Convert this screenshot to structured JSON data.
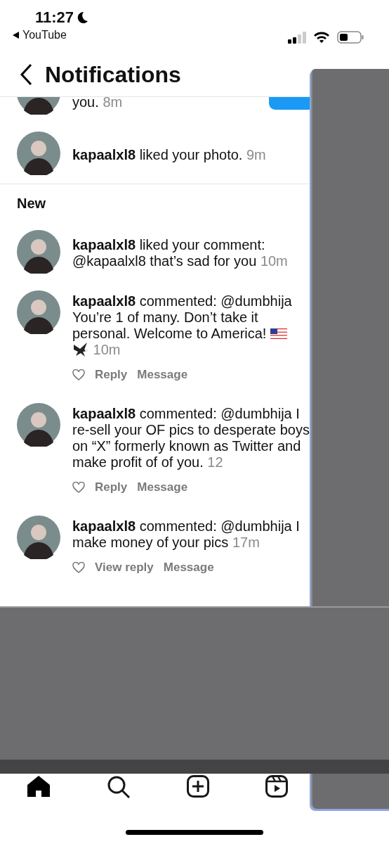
{
  "status_bar": {
    "time": "11:27",
    "back_app": "YouTube"
  },
  "header": {
    "title": "Notifications"
  },
  "earlier": [
    {
      "kind": "partial",
      "text": "you.",
      "time": "8m",
      "button": true
    },
    {
      "kind": "like",
      "text": "**kapaalxl8** liked your photo.",
      "time": "9m"
    }
  ],
  "new_section": {
    "title": "New",
    "items": [
      {
        "kind": "like",
        "text": "**kapaalxl8** liked your comment: @kapaalxl8 that’s sad for you",
        "time": "10m"
      },
      {
        "kind": "comment",
        "text": "**kapaalxl8** commented: @dumbhija You’re 1 of many. Don’t take it personal. Welcome to America!",
        "emojis": true,
        "time": "10m",
        "actions": [
          "Reply",
          "Message"
        ]
      },
      {
        "kind": "comment",
        "text": "**kapaalxl8** commented: @dumbhija I re-sell your OF pics to desperate boys on “X”  formerly known as Twitter and make profit of of you.",
        "time": "12",
        "actions": [
          "Reply",
          "Message"
        ]
      },
      {
        "kind": "comment",
        "text": "**kapaalxl8** commented: @dumbhija I make money of your pics",
        "time": "17m",
        "actions": [
          "View reply",
          "Message"
        ]
      }
    ]
  },
  "tab_bar": [
    {
      "kind": "home",
      "selected": true
    },
    {
      "kind": "search",
      "selected": false
    },
    {
      "kind": "create",
      "selected": false
    },
    {
      "kind": "reels",
      "selected": false
    }
  ]
}
